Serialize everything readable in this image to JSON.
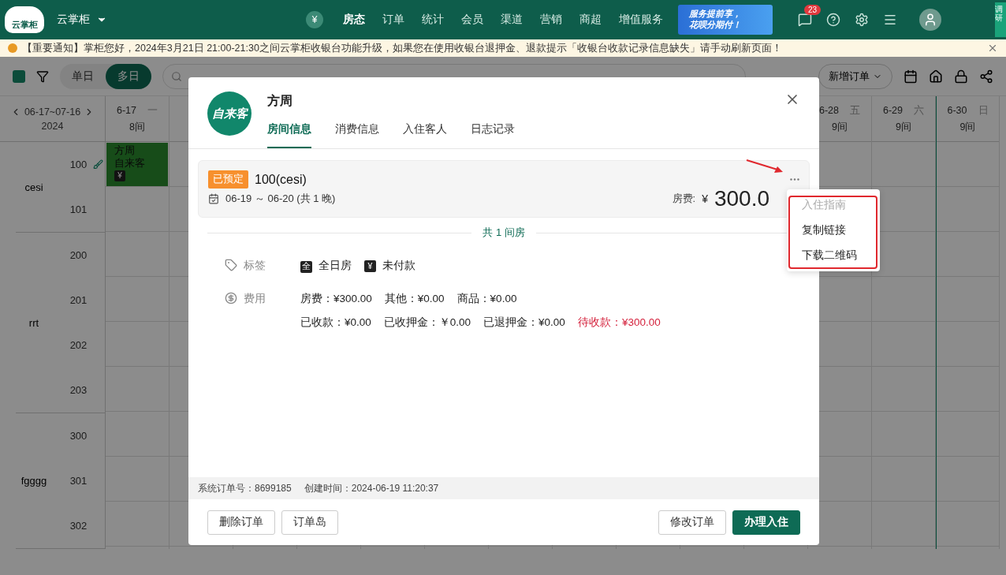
{
  "topbar": {
    "logo": "云掌柜",
    "store": "云掌柜",
    "nav": [
      {
        "label": "房态",
        "selected": true
      },
      {
        "label": "订单",
        "selected": false
      },
      {
        "label": "统计",
        "selected": false
      },
      {
        "label": "会员",
        "selected": false
      },
      {
        "label": "渠道",
        "selected": false
      },
      {
        "label": "营销",
        "selected": false
      },
      {
        "label": "商超",
        "selected": false
      },
      {
        "label": "增值服务",
        "selected": false
      }
    ],
    "banner": [
      "服务提前享，",
      "花呗分期付！"
    ],
    "message_count": "23",
    "survey": "调研"
  },
  "notice": "【重要通知】掌柜您好，2024年3月21日 21:00-21:30之间云掌柜收银台功能升级，如果您在使用收银台退押金、退款提示「收银台收款记录信息缺失」请手动刷新页面！",
  "toolbar": {
    "modes": [
      {
        "label": "单日",
        "selected": false
      },
      {
        "label": "多日",
        "selected": true
      }
    ],
    "new_order": "新增订单"
  },
  "calendar": {
    "range": "06-17~07-16",
    "year": "2024",
    "days_start": [
      {
        "date": "6-17",
        "weekday": "一",
        "rooms": "8间",
        "current": false
      }
    ],
    "days_end": [
      {
        "date": "6-28",
        "weekday": "五",
        "rooms": "9间",
        "current": false
      },
      {
        "date": "6-29",
        "weekday": "六",
        "rooms": "9间",
        "current": false
      },
      {
        "date": "6-30",
        "weekday": "日",
        "rooms": "9间",
        "current": true
      }
    ],
    "groups": [
      {
        "name": "cesi",
        "rooms": [
          {
            "number": "100",
            "dirty": true
          },
          {
            "number": "101",
            "dirty": false
          }
        ]
      },
      {
        "name": "rrt",
        "rooms": [
          {
            "number": "200",
            "dirty": false
          },
          {
            "number": "201",
            "dirty": false
          },
          {
            "number": "202",
            "dirty": false
          },
          {
            "number": "203",
            "dirty": false
          }
        ]
      },
      {
        "name": "fgggg",
        "rooms": [
          {
            "number": "300",
            "dirty": false
          },
          {
            "number": "301",
            "dirty": false
          },
          {
            "number": "302",
            "dirty": false
          }
        ]
      }
    ],
    "booking": {
      "guest": "方周",
      "source": "自来客",
      "badge": "¥"
    }
  },
  "dialog": {
    "avatar": "自来客",
    "guest": "方周",
    "tabs": [
      {
        "label": "房间信息",
        "selected": true
      },
      {
        "label": "消费信息",
        "selected": false
      },
      {
        "label": "入住客人",
        "selected": false
      },
      {
        "label": "日志记录",
        "selected": false
      }
    ],
    "room": {
      "status": "已预定",
      "name": "100(cesi)",
      "dates": "06-19 ～ 06-20 (共 1 晚)",
      "fee_label": "房费:",
      "currency": "¥",
      "fee": "300.0"
    },
    "room_count": "共 1 间房",
    "tags_label": "标签",
    "tags": [
      {
        "icon": "全",
        "text": "全日房"
      },
      {
        "icon": "¥",
        "text": "未付款"
      }
    ],
    "costs_label": "费用",
    "costs": [
      [
        {
          "text": "房费：¥300.00",
          "alert": false
        },
        {
          "text": "其他：¥0.00",
          "alert": false
        },
        {
          "text": "商品：¥0.00",
          "alert": false
        }
      ],
      [
        {
          "text": "已收款：¥0.00",
          "alert": false
        },
        {
          "text": "已收押金：￥0.00",
          "alert": false
        },
        {
          "text": "已退押金：¥0.00",
          "alert": false
        },
        {
          "text": "待收款：¥300.00",
          "alert": true
        }
      ]
    ],
    "order_no": "系统订单号：8699185",
    "created": "创建时间：2024-06-19 11:20:37",
    "left_buttons": [
      "删除订单",
      "订单岛"
    ],
    "buttons": [
      {
        "label": "修改订单",
        "primary": false
      },
      {
        "label": "办理入住",
        "primary": true
      }
    ],
    "menu": [
      {
        "label": "入住指南",
        "disabled": true
      },
      {
        "label": "复制链接",
        "disabled": false
      },
      {
        "label": "下载二维码",
        "disabled": false
      }
    ]
  }
}
